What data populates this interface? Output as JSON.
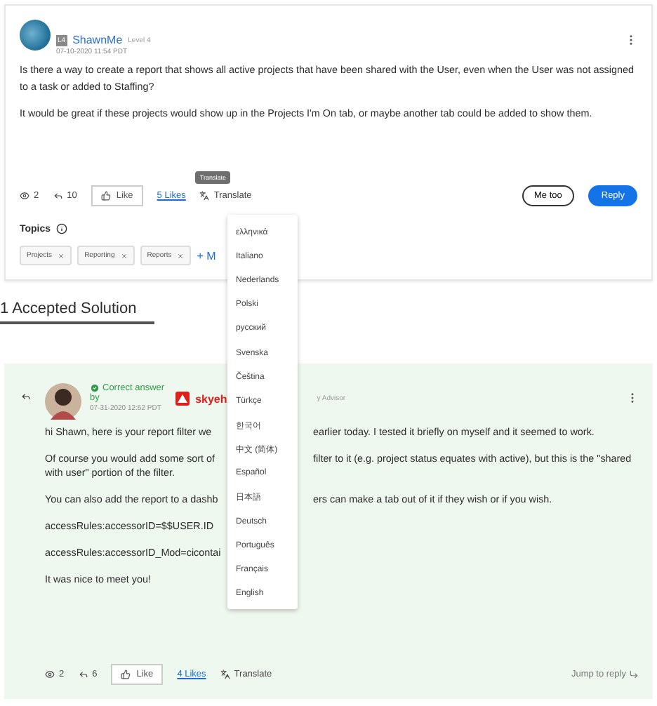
{
  "question": {
    "badge": "L4",
    "author": "ShawnMe",
    "level": "Level 4",
    "date": "07-10-2020 11:54 PDT",
    "paragraphs": [
      "Is there a way to create a report that shows all active projects that have been shared with the User, even when the User was not assigned to a task or added to Staffing?",
      "It would be great if these projects would show up in the Projects I'm On tab, or maybe another tab could be added to show them."
    ],
    "views": "2",
    "replies": "10",
    "like": "Like",
    "likes": "5 Likes",
    "translate": "Translate",
    "tooltip": "Translate",
    "me_too": "Me too",
    "reply": "Reply",
    "topics_heading": "Topics",
    "tags": [
      "Projects",
      "Reporting",
      "Reports"
    ],
    "add_tag": "+ M"
  },
  "solutions_heading": "1 Accepted Solution",
  "answer": {
    "badge": "Correct answer",
    "by": "by",
    "author": "skyeh",
    "role": "y Advisor",
    "date": "07-31-2020 12:52 PDT",
    "lines": [
      {
        "before": "hi Shawn, here is your report filter we",
        "after": "earlier today. I tested it briefly on myself and it seemed to work."
      },
      {
        "before": "Of course you would add some sort of",
        "after": "filter to it (e.g. project status equates with active), but this is the \"shared"
      },
      {
        "before": "with user\" portion of the filter."
      },
      {
        "before": "You can also add the report to a dashb",
        "after": "ers can make a tab out of it if they wish or if you wish."
      },
      {
        "before": "accessRules:accessorID=$$USER.ID"
      },
      {
        "before": "accessRules:accessorID_Mod=cicontai"
      },
      {
        "before": "It was nice to meet you!"
      }
    ],
    "views": "2",
    "replies": "6",
    "like": "Like",
    "likes": "4 Likes",
    "translate": "Translate",
    "jump": "Jump to reply"
  },
  "language_menu": [
    "ελληνικά",
    "Italiano",
    "Nederlands",
    "Polski",
    "русский",
    "Svenska",
    "Čeština",
    "Türkçe",
    "한국어",
    "中文 (简体)",
    "Español",
    "日本語",
    "Deutsch",
    "Português",
    "Français",
    "English"
  ]
}
